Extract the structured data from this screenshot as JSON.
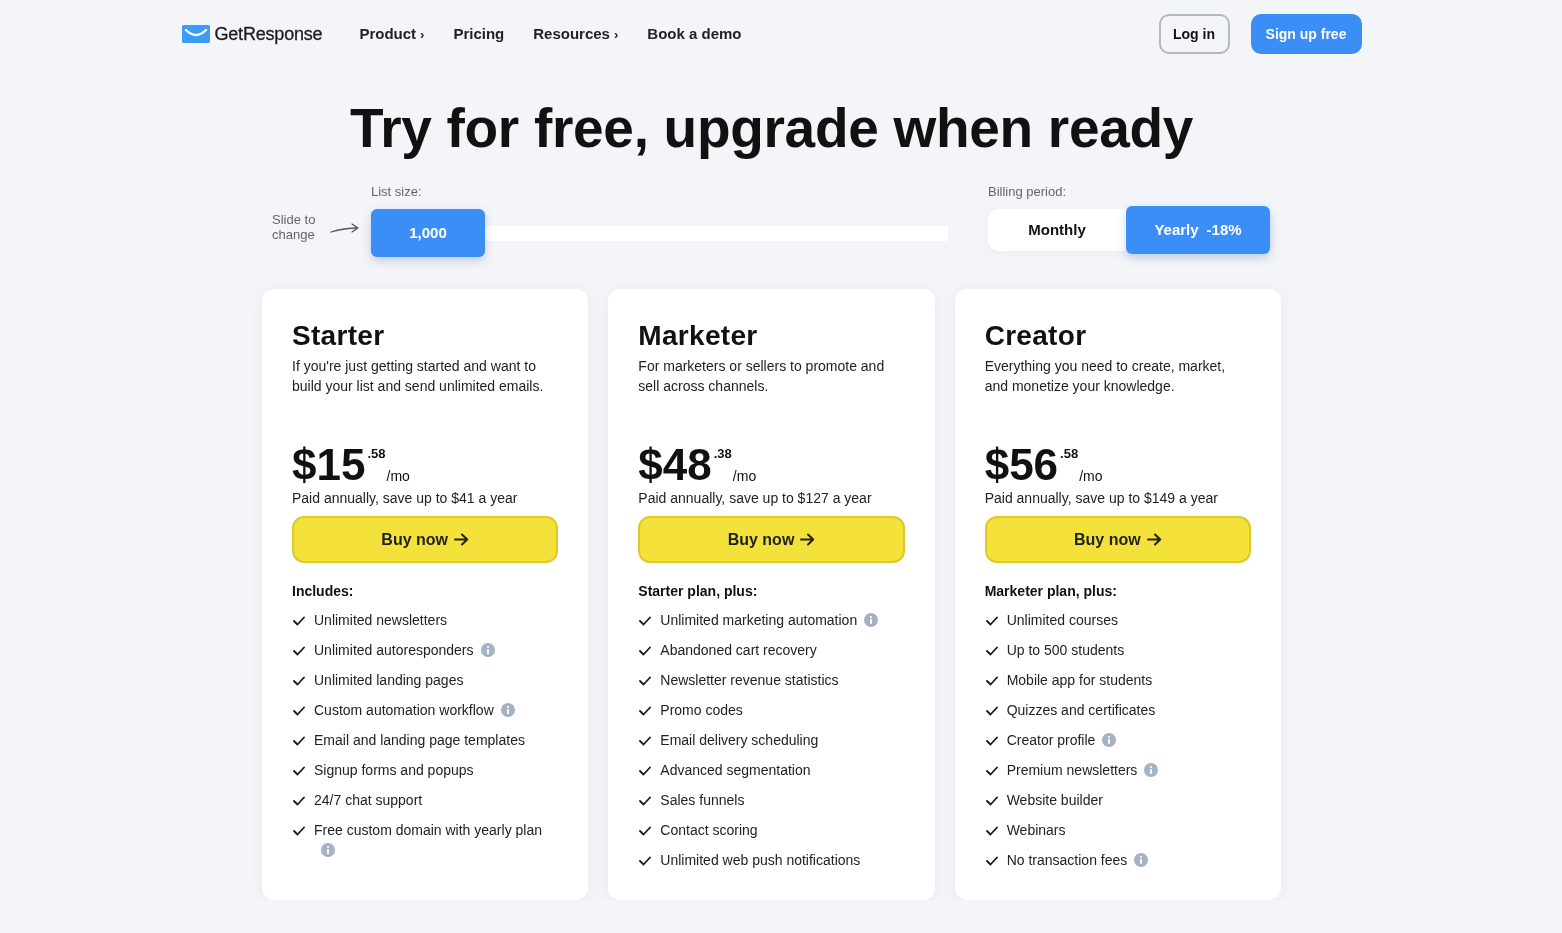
{
  "nav": {
    "brand": "GetResponse",
    "links": [
      {
        "label": "Product",
        "caret": "›"
      },
      {
        "label": "Pricing"
      },
      {
        "label": "Resources",
        "caret": "›"
      },
      {
        "label": "Book a demo"
      }
    ],
    "login": "Log in",
    "signup": "Sign up free"
  },
  "hero": {
    "title": "Try for free, upgrade when ready"
  },
  "list_size": {
    "hint": "Slide to change",
    "label": "List size:",
    "value": "1,000",
    "level": 0
  },
  "billing": {
    "label": "Billing period:",
    "options": [
      {
        "label": "Monthly",
        "selected": false
      },
      {
        "label": "Yearly",
        "discount": "-18%",
        "selected": true
      }
    ]
  },
  "plans": [
    {
      "name": "Starter",
      "description": "If you're just getting started and want to build your list and send unlimited emails.",
      "price": {
        "amount": "$15",
        "cents": ".58",
        "period": "/mo"
      },
      "note": "Paid annually, save up to $41 a year",
      "button": "Buy now",
      "features_heading": "Includes:",
      "features": [
        {
          "text": "Unlimited newsletters",
          "info": false
        },
        {
          "text": "Unlimited autoresponders",
          "info": true
        },
        {
          "text": "Unlimited landing pages",
          "info": false
        },
        {
          "text": "Custom automation workflow",
          "info": true
        },
        {
          "text": "Email and landing page templates",
          "info": false
        },
        {
          "text": "Signup forms and popups",
          "info": false
        },
        {
          "text": "24/7 chat support",
          "info": false
        },
        {
          "text": "Free custom domain with yearly plan",
          "info": true
        }
      ]
    },
    {
      "name": "Marketer",
      "description": "For marketers or sellers to promote and sell across channels.",
      "price": {
        "amount": "$48",
        "cents": ".38",
        "period": "/mo"
      },
      "note": "Paid annually, save up to $127 a year",
      "button": "Buy now",
      "features_heading": "Starter plan, plus:",
      "features": [
        {
          "text": "Unlimited marketing automation",
          "info": true
        },
        {
          "text": "Abandoned cart recovery",
          "info": false
        },
        {
          "text": "Newsletter revenue statistics",
          "info": false
        },
        {
          "text": "Promo codes",
          "info": false
        },
        {
          "text": "Email delivery scheduling",
          "info": false
        },
        {
          "text": "Advanced segmentation",
          "info": false
        },
        {
          "text": "Sales funnels",
          "info": false
        },
        {
          "text": "Contact scoring",
          "info": false
        },
        {
          "text": "Unlimited web push notifications",
          "info": false
        }
      ]
    },
    {
      "name": "Creator",
      "description": "Everything you need to create, market, and monetize your knowledge.",
      "price": {
        "amount": "$56",
        "cents": ".58",
        "period": "/mo"
      },
      "note": "Paid annually, save up to $149 a year",
      "button": "Buy now",
      "features_heading": "Marketer plan, plus:",
      "features": [
        {
          "text": "Unlimited courses",
          "info": false
        },
        {
          "text": "Up to 500 students",
          "info": false
        },
        {
          "text": "Mobile app for students",
          "info": false
        },
        {
          "text": "Quizzes and certificates",
          "info": false
        },
        {
          "text": "Creator profile",
          "info": true
        },
        {
          "text": "Premium newsletters",
          "info": true
        },
        {
          "text": "Website builder",
          "info": false
        },
        {
          "text": "Webinars",
          "info": false
        },
        {
          "text": "No transaction fees",
          "info": true
        }
      ]
    }
  ]
}
